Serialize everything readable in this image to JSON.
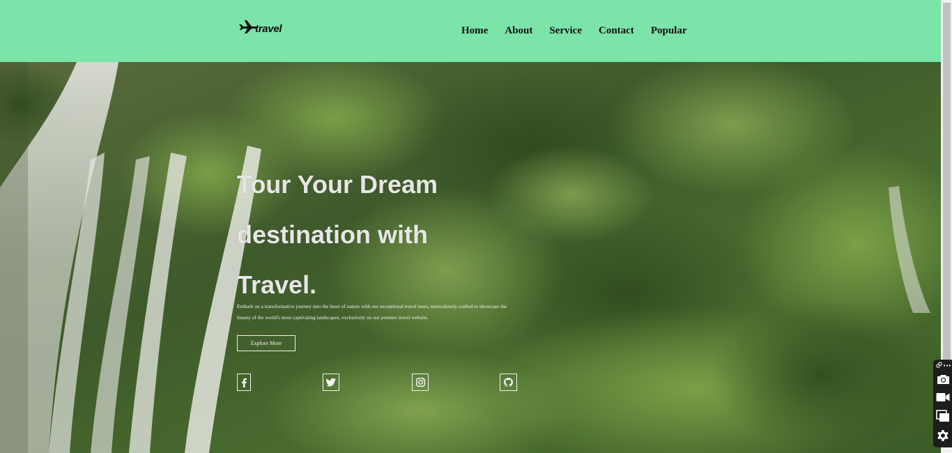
{
  "brand": {
    "logo_text": "travel"
  },
  "nav": {
    "items": [
      {
        "label": "Home"
      },
      {
        "label": "About"
      },
      {
        "label": "Service"
      },
      {
        "label": "Contact"
      },
      {
        "label": "Popular"
      }
    ]
  },
  "hero": {
    "title_lines": [
      "Tour Your Dream",
      "destination with",
      "Travel."
    ],
    "description": "Embark on a transformative journey into the heart of nature with our exceptional travel tours, meticulously crafted to showcase the beauty of the world's most captivating landscapes, exclusively on our premier travel website.",
    "cta_label": "Explore More",
    "social": [
      {
        "icon": "facebook-icon"
      },
      {
        "icon": "twitter-icon"
      },
      {
        "icon": "instagram-icon"
      },
      {
        "icon": "github-icon"
      }
    ]
  },
  "toolbar": {
    "buttons": [
      {
        "icon": "camera-icon"
      },
      {
        "icon": "video-camera-icon"
      },
      {
        "icon": "window-copy-icon"
      },
      {
        "icon": "gear-icon"
      }
    ]
  },
  "colors": {
    "header_bg": "#7ce3a9",
    "hero_text": "#e6e6e6",
    "nav_text": "#111111"
  }
}
